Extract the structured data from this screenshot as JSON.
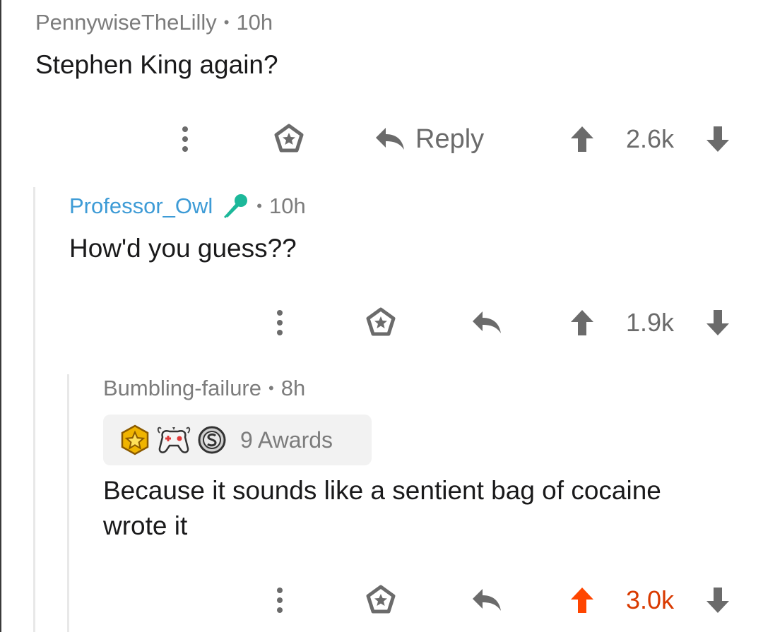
{
  "comments": [
    {
      "author": "PennywiseTheLilly",
      "age": "10h",
      "text": "Stephen King again?",
      "reply_label": "Reply",
      "score": "2.6k",
      "upvoted": false
    },
    {
      "author": "Professor_Owl",
      "author_flair": "microphone-icon",
      "age": "10h",
      "text": "How'd you guess??",
      "score": "1.9k",
      "upvoted": false
    },
    {
      "author": "Bumbling-failure",
      "age": "8h",
      "awards_label": "9 Awards",
      "awards": [
        "gold-star-award-icon",
        "wholesome-controller-award-icon",
        "silver-coin-award-icon"
      ],
      "text": "Because it sounds like a sentient bag of cocaine wrote it",
      "score": "3.0k",
      "upvoted": true
    }
  ],
  "separator": "•",
  "colors": {
    "upvote_active": "#ff4500",
    "score_active": "#d93a00",
    "author_link": "#3d9bd6",
    "flair_teal": "#1cb89a",
    "muted": "#7c7c7c"
  }
}
